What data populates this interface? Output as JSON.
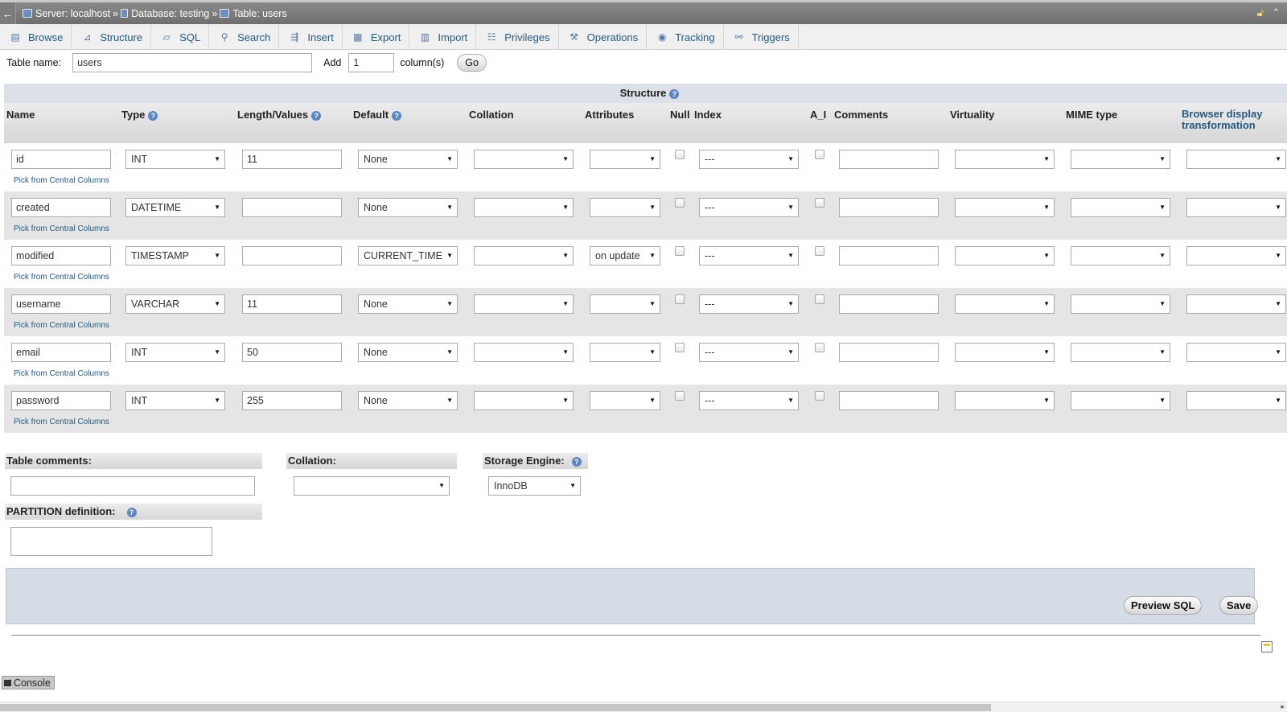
{
  "breadcrumb": {
    "server": "Server: localhost",
    "database": "Database: testing",
    "table": "Table: users",
    "separator": "»"
  },
  "tabs": [
    {
      "label": "Browse",
      "icon": "browse-icon"
    },
    {
      "label": "Structure",
      "icon": "structure-icon"
    },
    {
      "label": "SQL",
      "icon": "sql-icon"
    },
    {
      "label": "Search",
      "icon": "search-icon"
    },
    {
      "label": "Insert",
      "icon": "insert-icon"
    },
    {
      "label": "Export",
      "icon": "export-icon"
    },
    {
      "label": "Import",
      "icon": "import-icon"
    },
    {
      "label": "Privileges",
      "icon": "privileges-icon"
    },
    {
      "label": "Operations",
      "icon": "operations-icon"
    },
    {
      "label": "Tracking",
      "icon": "tracking-icon"
    },
    {
      "label": "Triggers",
      "icon": "triggers-icon"
    }
  ],
  "table_form": {
    "table_name_label": "Table name:",
    "table_name_value": "users",
    "add_label": "Add",
    "add_value": "1",
    "columns_label": "column(s)",
    "go_label": "Go"
  },
  "structure": {
    "title": "Structure",
    "headers": {
      "name": "Name",
      "type": "Type",
      "length": "Length/Values",
      "default": "Default",
      "collation": "Collation",
      "attributes": "Attributes",
      "null": "Null",
      "index": "Index",
      "ai": "A_I",
      "comments": "Comments",
      "virtuality": "Virtuality",
      "mime": "MIME type",
      "browser_display_1": "Browser display",
      "browser_display_2": "transformation"
    },
    "pick_label": "Pick from Central Columns",
    "rows": [
      {
        "name": "id",
        "type": "INT",
        "length": "11",
        "default": "None",
        "collation": "",
        "attributes": "",
        "index": "---"
      },
      {
        "name": "created",
        "type": "DATETIME",
        "length": "",
        "default": "None",
        "collation": "",
        "attributes": "",
        "index": "---"
      },
      {
        "name": "modified",
        "type": "TIMESTAMP",
        "length": "",
        "default": "CURRENT_TIME",
        "collation": "",
        "attributes": "on update",
        "index": "---"
      },
      {
        "name": "username",
        "type": "VARCHAR",
        "length": "11",
        "default": "None",
        "collation": "",
        "attributes": "",
        "index": "---"
      },
      {
        "name": "email",
        "type": "INT",
        "length": "50",
        "default": "None",
        "collation": "",
        "attributes": "",
        "index": "---"
      },
      {
        "name": "password",
        "type": "INT",
        "length": "255",
        "default": "None",
        "collation": "",
        "attributes": "",
        "index": "---"
      }
    ]
  },
  "lower": {
    "table_comments_label": "Table comments:",
    "collation_label": "Collation:",
    "storage_engine_label": "Storage Engine:",
    "storage_engine_value": "InnoDB",
    "partition_label": "PARTITION definition:"
  },
  "actions": {
    "preview_sql": "Preview SQL",
    "save": "Save"
  },
  "console_label": "Console"
}
